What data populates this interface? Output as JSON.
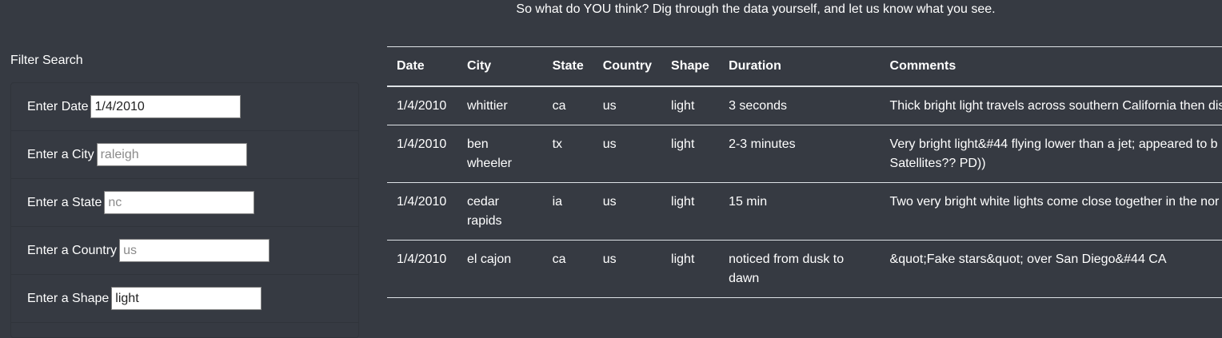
{
  "intro_text": "So what do YOU think? Dig through the data yourself, and let us know what you see.",
  "filter": {
    "title": "Filter Search",
    "fields": [
      {
        "label": "Enter Date",
        "value": "1/4/2010",
        "placeholder": ""
      },
      {
        "label": "Enter a City",
        "value": "",
        "placeholder": "raleigh"
      },
      {
        "label": "Enter a State",
        "value": "",
        "placeholder": "nc"
      },
      {
        "label": "Enter a Country",
        "value": "",
        "placeholder": "us"
      },
      {
        "label": "Enter a Shape",
        "value": "light",
        "placeholder": ""
      }
    ]
  },
  "table": {
    "headers": [
      "Date",
      "City",
      "State",
      "Country",
      "Shape",
      "Duration",
      "Comments"
    ],
    "rows": [
      [
        "1/4/2010",
        "whittier",
        "ca",
        "us",
        "light",
        "3 seconds",
        "Thick bright light travels across southern California then dis"
      ],
      [
        "1/4/2010",
        "ben wheeler",
        "tx",
        "us",
        "light",
        "2-3 minutes",
        "Very bright light&#44 flying lower than a jet; appeared to b Satellites?? PD))"
      ],
      [
        "1/4/2010",
        "cedar rapids",
        "ia",
        "us",
        "light",
        "15 min",
        "Two very bright white lights come close together in the nor"
      ],
      [
        "1/4/2010",
        "el cajon",
        "ca",
        "us",
        "light",
        "noticed from dusk to dawn",
        "&quot;Fake stars&quot; over San Diego&#44 CA"
      ]
    ]
  }
}
